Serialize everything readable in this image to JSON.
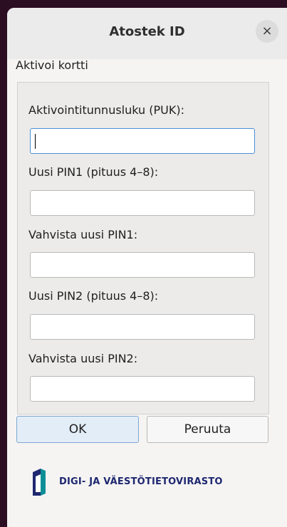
{
  "dialog": {
    "title": "Atostek ID",
    "close_symbol": "×"
  },
  "group": {
    "title": "Aktivoi kortti",
    "fields": [
      {
        "label": "Aktivointitunnusluku (PUK):",
        "value": ""
      },
      {
        "label": "Uusi PIN1 (pituus 4–8):",
        "value": ""
      },
      {
        "label": "Vahvista uusi PIN1:",
        "value": ""
      },
      {
        "label": "Uusi PIN2 (pituus 4–8):",
        "value": ""
      },
      {
        "label": "Vahvista uusi PIN2:",
        "value": ""
      }
    ]
  },
  "buttons": {
    "ok": "OK",
    "cancel": "Peruuta"
  },
  "footer": {
    "org_name": "DIGI- JA VÄESTÖTIETOVIRASTO",
    "brand_color": "#1e2770",
    "accent_color": "#0e8f96"
  }
}
